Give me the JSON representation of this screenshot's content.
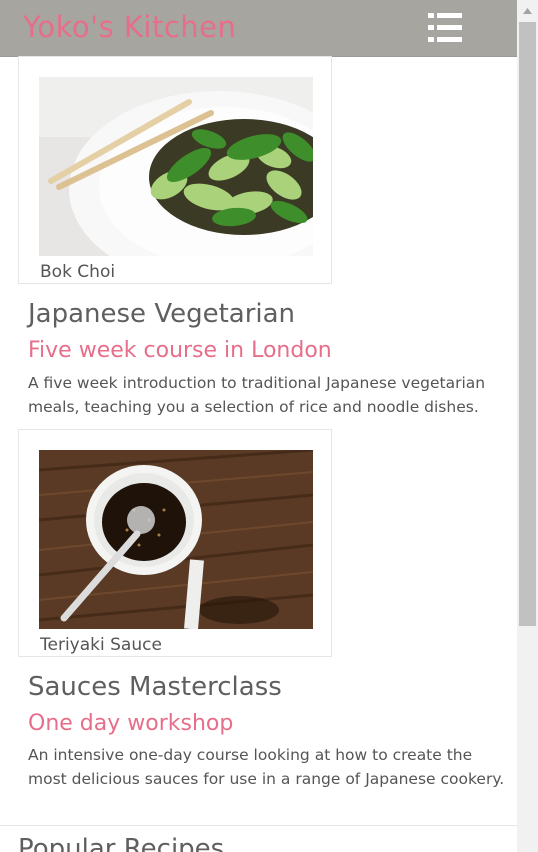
{
  "header": {
    "brand": "Yoko's Kitchen",
    "menu_icon": "hamburger-list-icon"
  },
  "courses": [
    {
      "image_caption": "Bok Choi",
      "title": "Japanese Vegetarian",
      "subtitle": "Five week course in London",
      "description": "A five week introduction to traditional Japanese vegetarian meals, teaching you a selection of rice and noodle dishes."
    },
    {
      "image_caption": "Teriyaki Sauce",
      "title": "Sauces Masterclass",
      "subtitle": "One day workshop",
      "description": "An intensive one-day course looking at how to create the most delicious sauces for use in a range of Japanese cookery."
    }
  ],
  "next_section": {
    "title": "Popular Recipes"
  },
  "colors": {
    "header_bg": "#a7a59f",
    "accent": "#e76e8a",
    "text": "#555555"
  }
}
